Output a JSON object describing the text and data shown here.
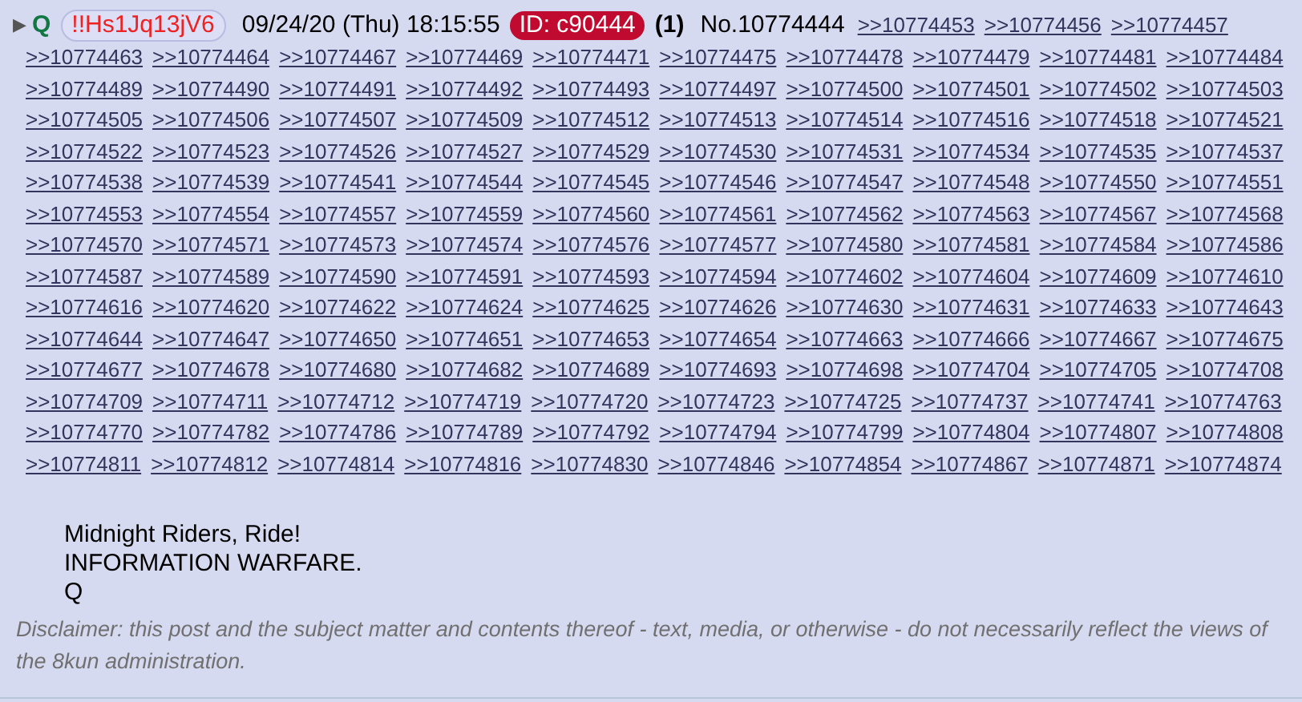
{
  "post": {
    "expander": "▶",
    "name": "Q",
    "tripcode": "!!Hs1Jq13jV6",
    "date": "09/24/20 (Thu) 18:15:55",
    "poster_id": "ID: c90444",
    "id_count": "(1)",
    "number": "No.10774444",
    "replies": [
      ">>10774453",
      ">>10774456",
      ">>10774457",
      ">>10774463",
      ">>10774464",
      ">>10774467",
      ">>10774469",
      ">>10774471",
      ">>10774475",
      ">>10774478",
      ">>10774479",
      ">>10774481",
      ">>10774484",
      ">>10774489",
      ">>10774490",
      ">>10774491",
      ">>10774492",
      ">>10774493",
      ">>10774497",
      ">>10774500",
      ">>10774501",
      ">>10774502",
      ">>10774503",
      ">>10774505",
      ">>10774506",
      ">>10774507",
      ">>10774509",
      ">>10774512",
      ">>10774513",
      ">>10774514",
      ">>10774516",
      ">>10774518",
      ">>10774521",
      ">>10774522",
      ">>10774523",
      ">>10774526",
      ">>10774527",
      ">>10774529",
      ">>10774530",
      ">>10774531",
      ">>10774534",
      ">>10774535",
      ">>10774537",
      ">>10774538",
      ">>10774539",
      ">>10774541",
      ">>10774544",
      ">>10774545",
      ">>10774546",
      ">>10774547",
      ">>10774548",
      ">>10774550",
      ">>10774551",
      ">>10774553",
      ">>10774554",
      ">>10774557",
      ">>10774559",
      ">>10774560",
      ">>10774561",
      ">>10774562",
      ">>10774563",
      ">>10774567",
      ">>10774568",
      ">>10774570",
      ">>10774571",
      ">>10774573",
      ">>10774574",
      ">>10774576",
      ">>10774577",
      ">>10774580",
      ">>10774581",
      ">>10774584",
      ">>10774586",
      ">>10774587",
      ">>10774589",
      ">>10774590",
      ">>10774591",
      ">>10774593",
      ">>10774594",
      ">>10774602",
      ">>10774604",
      ">>10774609",
      ">>10774610",
      ">>10774616",
      ">>10774620",
      ">>10774622",
      ">>10774624",
      ">>10774625",
      ">>10774626",
      ">>10774630",
      ">>10774631",
      ">>10774633",
      ">>10774643",
      ">>10774644",
      ">>10774647",
      ">>10774650",
      ">>10774651",
      ">>10774653",
      ">>10774654",
      ">>10774663",
      ">>10774666",
      ">>10774667",
      ">>10774675",
      ">>10774677",
      ">>10774678",
      ">>10774680",
      ">>10774682",
      ">>10774689",
      ">>10774693",
      ">>10774698",
      ">>10774704",
      ">>10774705",
      ">>10774708",
      ">>10774709",
      ">>10774711",
      ">>10774712",
      ">>10774719",
      ">>10774720",
      ">>10774723",
      ">>10774725",
      ">>10774737",
      ">>10774741",
      ">>10774763",
      ">>10774770",
      ">>10774782",
      ">>10774786",
      ">>10774789",
      ">>10774792",
      ">>10774794",
      ">>10774799",
      ">>10774804",
      ">>10774807",
      ">>10774808",
      ">>10774811",
      ">>10774812",
      ">>10774814",
      ">>10774816",
      ">>10774830",
      ">>10774846",
      ">>10774854",
      ">>10774867",
      ">>10774871",
      ">>10774874"
    ],
    "body": [
      "Midnight Riders, Ride!",
      "INFORMATION WARFARE.",
      "Q"
    ],
    "disclaimer": "Disclaimer: this post and the subject matter and contents thereof - text, media, or otherwise - do not necessarily reflect the views of the 8kun administration."
  }
}
